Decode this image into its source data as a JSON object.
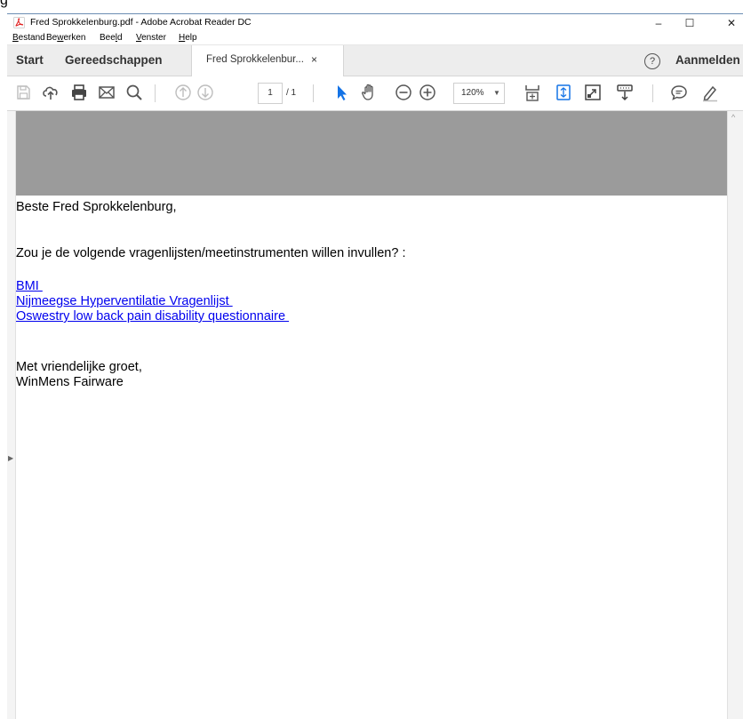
{
  "window": {
    "fragment_glyph": "g",
    "title": "Fred Sprokkelenburg.pdf - Adobe Acrobat Reader DC",
    "controls": {
      "minimize": "–",
      "maximize": "☐",
      "close": "✕"
    }
  },
  "menubar": {
    "items": [
      {
        "label": "Bestand",
        "underline": "B",
        "rest": "estand"
      },
      {
        "label": "Bewerken",
        "before": "Be",
        "underline": "w",
        "rest": "erken"
      },
      {
        "label": "Beeld",
        "before": "Bee",
        "underline": "l",
        "rest": "d"
      },
      {
        "label": "Venster",
        "underline": "V",
        "rest": "enster"
      },
      {
        "label": "Help",
        "underline": "H",
        "rest": "elp"
      }
    ]
  },
  "tabs": {
    "start": "Start",
    "tools": "Gereedschappen",
    "document": "Fred Sprokkelenbur...",
    "document_close": "×",
    "help": "?",
    "signin": "Aanmelden"
  },
  "toolbar": {
    "page_current": "1",
    "page_total": "/ 1",
    "zoom": "120%",
    "zoom_arrow": "▼"
  },
  "document": {
    "greeting": "Beste Fred Sprokkelenburg,",
    "question": "Zou je de volgende vragenlijsten/meetinstrumenten willen invullen? :",
    "links": [
      "BMI ",
      "Nijmeegse Hyperventilatie Vragenlijst ",
      "Oswestry low back pain disability questionnaire "
    ],
    "closing": "Met vriendelijke groet,",
    "signature": "WinMens Fairware"
  },
  "colors": {
    "link": "#0000ee",
    "header_band": "#9b9b9b",
    "select_tool": "#1473e6",
    "title_border": "#6c8db3"
  },
  "icons": {
    "app": "acrobat-icon",
    "save": "save-icon",
    "upload": "upload-cloud-icon",
    "print": "print-icon",
    "email": "email-icon",
    "search": "search-icon",
    "prev": "previous-page-icon",
    "next": "next-page-icon",
    "select": "select-arrow-icon",
    "hand": "hand-tool-icon",
    "zoom_out": "zoom-out-icon",
    "zoom_in": "zoom-in-icon",
    "fit": "fit-page-icon",
    "scroll_mode": "scrolling-mode-icon",
    "fullscreen": "full-screen-icon",
    "read_mode": "read-mode-icon",
    "comment": "comment-icon",
    "highlight": "highlight-pen-icon"
  }
}
